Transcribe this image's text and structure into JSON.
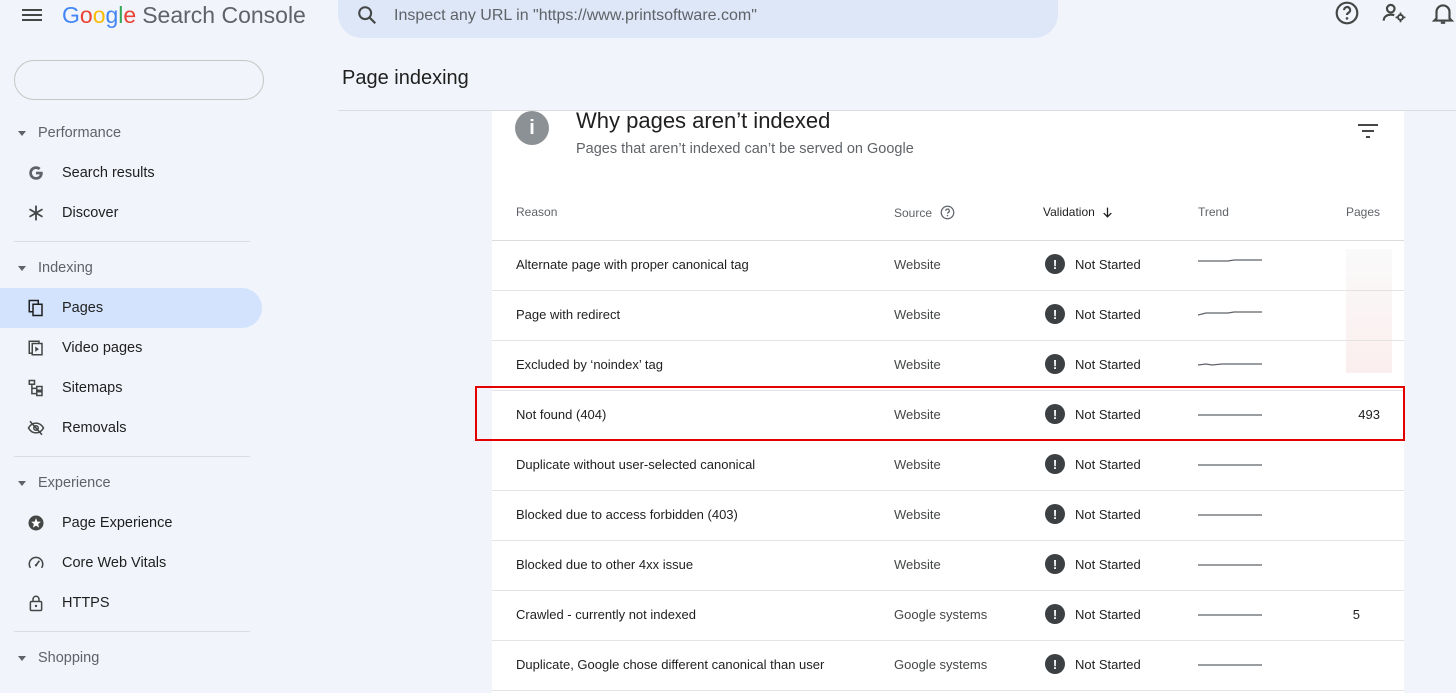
{
  "app": {
    "logo_letters": [
      "G",
      "o",
      "o",
      "g",
      "l",
      "e"
    ],
    "product_name": "Search Console"
  },
  "search": {
    "placeholder": "Inspect any URL in \"https://www.printsoftware.com\""
  },
  "topbar_icons": [
    "help-icon",
    "manage-users-icon",
    "notifications-icon"
  ],
  "sidebar": {
    "sections": [
      {
        "label": "Performance",
        "items": [
          {
            "label": "Search results",
            "icon": "google-g-icon"
          },
          {
            "label": "Discover",
            "icon": "asterisk-icon"
          }
        ]
      },
      {
        "label": "Indexing",
        "items": [
          {
            "label": "Pages",
            "icon": "pages-icon",
            "active": true
          },
          {
            "label": "Video pages",
            "icon": "video-pages-icon"
          },
          {
            "label": "Sitemaps",
            "icon": "sitemaps-icon"
          },
          {
            "label": "Removals",
            "icon": "removals-icon"
          }
        ]
      },
      {
        "label": "Experience",
        "items": [
          {
            "label": "Page Experience",
            "icon": "page-experience-icon"
          },
          {
            "label": "Core Web Vitals",
            "icon": "gauge-icon"
          },
          {
            "label": "HTTPS",
            "icon": "lock-icon"
          }
        ]
      },
      {
        "label": "Shopping",
        "items": []
      }
    ]
  },
  "main": {
    "page_title": "Page indexing",
    "card": {
      "title": "Why pages aren’t indexed",
      "subtitle": "Pages that aren’t indexed can’t be served on Google",
      "columns": {
        "reason": "Reason",
        "source": "Source",
        "validation": "Validation",
        "trend": "Trend",
        "pages": "Pages"
      },
      "rows": [
        {
          "reason": "Alternate page with proper canonical tag",
          "source": "Website",
          "validation": "Not Started",
          "pages": ""
        },
        {
          "reason": "Page with redirect",
          "source": "Website",
          "validation": "Not Started",
          "pages": ""
        },
        {
          "reason": "Excluded by ‘noindex’ tag",
          "source": "Website",
          "validation": "Not Started",
          "pages": ""
        },
        {
          "reason": "Not found (404)",
          "source": "Website",
          "validation": "Not Started",
          "pages": "493"
        },
        {
          "reason": "Duplicate without user-selected canonical",
          "source": "Website",
          "validation": "Not Started",
          "pages": ""
        },
        {
          "reason": "Blocked due to access forbidden (403)",
          "source": "Website",
          "validation": "Not Started",
          "pages": ""
        },
        {
          "reason": "Blocked due to other 4xx issue",
          "source": "Website",
          "validation": "Not Started",
          "pages": ""
        },
        {
          "reason": "Crawled - currently not indexed",
          "source": "Google systems",
          "validation": "Not Started",
          "pages": "5"
        },
        {
          "reason": "Duplicate, Google chose different canonical than user",
          "source": "Google systems",
          "validation": "Not Started",
          "pages": ""
        }
      ]
    }
  },
  "colors": {
    "accent_active": "#d3e3fd",
    "highlight_box": "#e50000",
    "search_bg": "#dde7f7"
  }
}
